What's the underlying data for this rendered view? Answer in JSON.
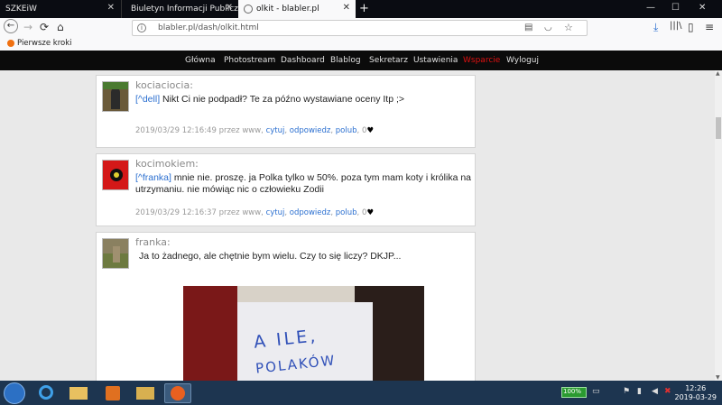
{
  "tabs": [
    {
      "label": "SZKEiW",
      "close": "✕"
    },
    {
      "label": "Biuletyn Informacji Publicznej",
      "close": "✕"
    },
    {
      "label": "olkit - blabler.pl",
      "close": "✕"
    }
  ],
  "newtab": "+",
  "window": {
    "minimize": "—",
    "maximize": "☐",
    "close": "✕"
  },
  "address": {
    "url": "blabler.pl/dash/olkit.html"
  },
  "bookmarks": [
    {
      "label": "Pierwsze kroki"
    }
  ],
  "site_nav": [
    "Główna",
    "Photostream",
    "Dashboard",
    "Blablog",
    "Sekretarz",
    "Ustawienia",
    "Wsparcie",
    "Wyloguj"
  ],
  "colors": {
    "accent_link": "#2b6fd0",
    "nav_highlight": "#e01010"
  },
  "posts": [
    {
      "author": "kociaciocia:",
      "ref": "[^dell]",
      "text": " Nikt Ci nie podpadł? Te za późno wystawiane oceny Itp ;>",
      "meta_prefix": "2019/03/29 12:16:49 przez www,",
      "cytuj": "cytuj",
      "odpowiedz": "odpowiedz",
      "polub": "polub",
      "count": "0",
      "heart": "♥"
    },
    {
      "author": "kocimokiem:",
      "ref": "[^franka]",
      "text": " mnie nie. proszę. ja Polka tylko w 50%. poza tym mam koty i królika na utrzymaniu. nie mówiąc nic o człowieku Zodii",
      "meta_prefix": "2019/03/29 12:16:37 przez www,",
      "cytuj": "cytuj",
      "odpowiedz": "odpowiedz",
      "polub": "polub",
      "count": "0",
      "heart": "♥"
    },
    {
      "author": "franka:",
      "text": "Ja to żadnego, ale chętnie bym wielu. Czy to się liczy? DKJP...",
      "image_text_line1": "A ILE,",
      "image_text_line2": "POLAKÓW"
    }
  ],
  "taskbar": {
    "battery": "100%",
    "time": "12:26",
    "date": "2019-03-29"
  }
}
